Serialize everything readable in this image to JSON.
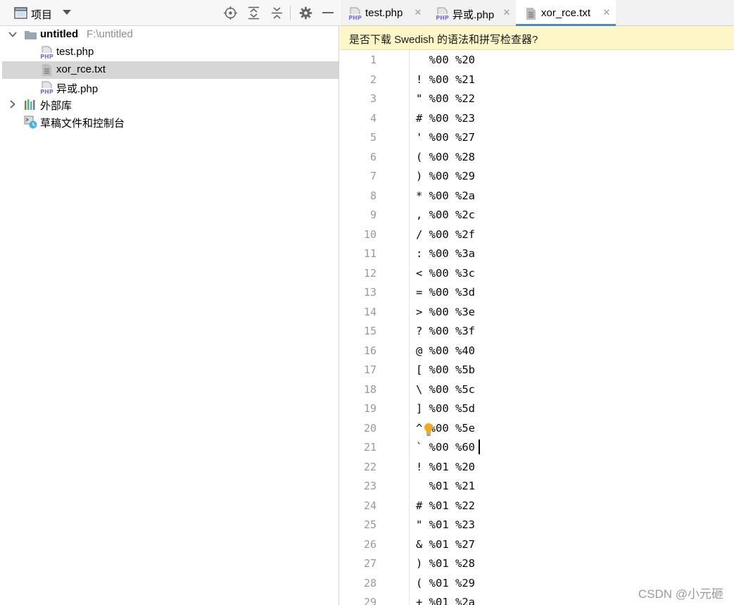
{
  "project_panel": {
    "title": "项目",
    "toolbar_icons": [
      "window-icon",
      "dropdown-arrow-icon",
      "locate-target-icon",
      "expand-all-icon",
      "collapse-all-icon",
      "gear-icon",
      "minimize-icon"
    ],
    "tree": {
      "root": {
        "label": "untitled",
        "hint": "F:\\untitled"
      },
      "files": [
        {
          "label": "test.php",
          "icon": "php-file-icon"
        },
        {
          "label": "xor_rce.txt",
          "icon": "text-file-icon"
        },
        {
          "label": "异或.php",
          "icon": "php-file-icon"
        }
      ],
      "external_libraries": "外部库",
      "scratches": "草稿文件和控制台"
    }
  },
  "editor": {
    "tabs": [
      {
        "label": "test.php",
        "icon": "php-file-icon"
      },
      {
        "label": "异或.php",
        "icon": "php-file-icon"
      },
      {
        "label": "xor_rce.txt",
        "icon": "text-file-icon"
      }
    ],
    "notification": "是否下载 Swedish 的语法和拼写检查器?",
    "lines": [
      {
        "n": "1",
        "text": "  %00 %20"
      },
      {
        "n": "2",
        "text": "! %00 %21"
      },
      {
        "n": "3",
        "text": "\" %00 %22"
      },
      {
        "n": "4",
        "text": "# %00 %23"
      },
      {
        "n": "5",
        "text": "' %00 %27"
      },
      {
        "n": "6",
        "text": "( %00 %28"
      },
      {
        "n": "7",
        "text": ") %00 %29"
      },
      {
        "n": "8",
        "text": "* %00 %2a"
      },
      {
        "n": "9",
        "text": ", %00 %2c"
      },
      {
        "n": "10",
        "text": "/ %00 %2f"
      },
      {
        "n": "11",
        "text": ": %00 %3a"
      },
      {
        "n": "12",
        "text": "< %00 %3c"
      },
      {
        "n": "13",
        "text": "= %00 %3d"
      },
      {
        "n": "14",
        "text": "> %00 %3e"
      },
      {
        "n": "15",
        "text": "? %00 %3f"
      },
      {
        "n": "16",
        "text": "@ %00 %40"
      },
      {
        "n": "17",
        "text": "[ %00 %5b"
      },
      {
        "n": "18",
        "text": "\\ %00 %5c"
      },
      {
        "n": "19",
        "text": "] %00 %5d"
      },
      {
        "n": "20",
        "text": "^ %00 %5e"
      },
      {
        "n": "21",
        "text": "` %00 %60"
      },
      {
        "n": "22",
        "text": "! %01 %20"
      },
      {
        "n": "23",
        "text": "  %01 %21"
      },
      {
        "n": "24",
        "text": "# %01 %22"
      },
      {
        "n": "25",
        "text": "\" %01 %23"
      },
      {
        "n": "26",
        "text": "& %01 %27"
      },
      {
        "n": "27",
        "text": ") %01 %28"
      },
      {
        "n": "28",
        "text": "( %01 %29"
      },
      {
        "n": "29",
        "text": "+ %01 %2a"
      }
    ]
  },
  "watermark": "CSDN @小元砸",
  "colors": {
    "accent": "#4a88c7",
    "selection": "#d5d5d5",
    "notification_bg": "#fdf6c6",
    "current_line": "#fbf9e9",
    "line_number": "#999999",
    "php_icon": "#7c6ad1"
  }
}
